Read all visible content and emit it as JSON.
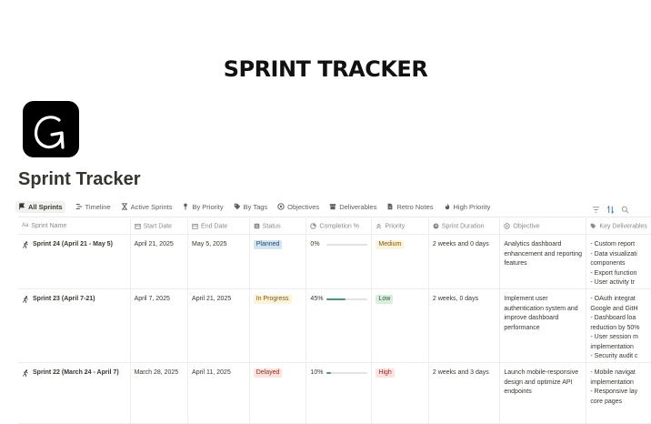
{
  "banner": {
    "title": "SPRINT TRACKER"
  },
  "page": {
    "title": "Sprint Tracker"
  },
  "tabs": [
    {
      "label": "All Sprints",
      "icon": "flag-icon",
      "active": true
    },
    {
      "label": "Timeline",
      "icon": "timeline-icon"
    },
    {
      "label": "Active Sprints",
      "icon": "hourglass-icon"
    },
    {
      "label": "By Priority",
      "icon": "pin-icon"
    },
    {
      "label": "By Tags",
      "icon": "tag-icon"
    },
    {
      "label": "Objectives",
      "icon": "target-icon"
    },
    {
      "label": "Deliverables",
      "icon": "archive-icon"
    },
    {
      "label": "Retro Notes",
      "icon": "document-icon"
    },
    {
      "label": "High Priority",
      "icon": "fire-icon"
    }
  ],
  "columns": [
    {
      "label": "Sprint Name",
      "icon": "text-icon"
    },
    {
      "label": "Start Date",
      "icon": "calendar-icon"
    },
    {
      "label": "End Date",
      "icon": "calendar-icon"
    },
    {
      "label": "Status",
      "icon": "status-icon"
    },
    {
      "label": "Completion %",
      "icon": "progress-icon"
    },
    {
      "label": "Priority",
      "icon": "chevrons-up-icon"
    },
    {
      "label": "Sprint Duration",
      "icon": "clock-icon"
    },
    {
      "label": "Objective",
      "icon": "target-icon"
    },
    {
      "label": "Key Deliverables",
      "icon": "tag-icon"
    }
  ],
  "rows": [
    {
      "name": "Sprint 24 (April 21 - May 5)",
      "start": "April 21, 2025",
      "end": "May 5, 2025",
      "status": "Planned",
      "status_bg": "#d3e5ef",
      "status_fg": "#28456c",
      "completion": 0,
      "completion_label": "0%",
      "priority": "Medium",
      "priority_bg": "#fbf3db",
      "priority_fg": "#7d5b12",
      "duration": "2 weeks and 0 days",
      "objective": "Analytics dashboard enhancement and reporting features",
      "deliverables": [
        "- Custom report",
        "- Data visualizati",
        "components",
        "- Export function",
        "- User activity tr"
      ]
    },
    {
      "name": "Sprint 23 (April 7-21)",
      "start": "April 7, 2025",
      "end": "April 21, 2025",
      "status": "In Progress",
      "status_bg": "#fbf3db",
      "status_fg": "#7d5b12",
      "completion": 45,
      "completion_label": "45%",
      "priority": "Low",
      "priority_bg": "#dbeddb",
      "priority_fg": "#2b593f",
      "duration": "2 weeks, 0 days",
      "objective": "Implement user authentication system and improve dashboard performance",
      "deliverables": [
        "- OAuth integrat",
        "Google and GitH",
        "- Dashboard loa",
        "reduction by 50%",
        "- User session m",
        "implementation",
        "- Security audit c"
      ]
    },
    {
      "name": "Sprint 22 (March 24 - April 7)",
      "start": "March 28, 2025",
      "end": "April 11, 2025",
      "status": "Delayed",
      "status_bg": "#ffe2dd",
      "status_fg": "#8a2f25",
      "completion": 10,
      "completion_label": "10%",
      "priority": "High",
      "priority_bg": "#ffe2dd",
      "priority_fg": "#8a2f25",
      "duration": "2 weeks and 3 days",
      "objective": "Launch mobile-responsive design and optimize API endpoints",
      "deliverables": [
        "- Mobile navigat",
        "implementation",
        "- Responsive lay",
        "core pages"
      ]
    }
  ],
  "colors": {
    "accent": "#4d9375",
    "border": "#ededeb",
    "muted": "#8b8a86"
  }
}
